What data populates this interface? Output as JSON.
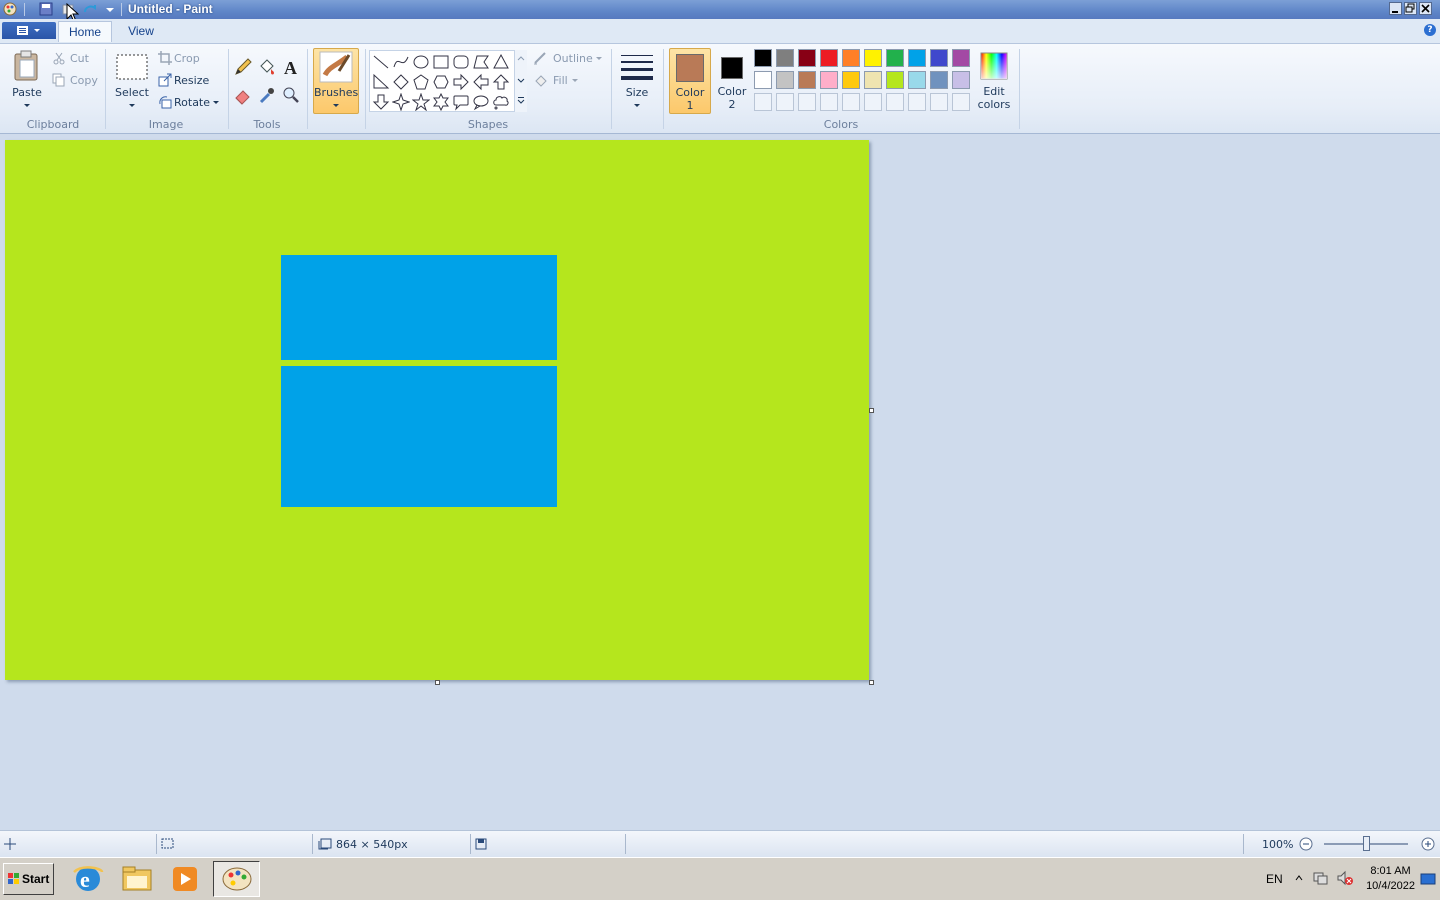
{
  "window": {
    "title": "Untitled - Paint"
  },
  "tabs": {
    "home": "Home",
    "view": "View"
  },
  "ribbon": {
    "clipboard": {
      "paste": "Paste",
      "cut": "Cut",
      "copy": "Copy",
      "group": "Clipboard"
    },
    "image": {
      "select": "Select",
      "crop": "Crop",
      "resize": "Resize",
      "rotate": "Rotate",
      "group": "Image"
    },
    "tools": {
      "group": "Tools"
    },
    "brushes": {
      "label": "Brushes"
    },
    "shapes": {
      "outline": "Outline",
      "fill": "Fill",
      "group": "Shapes"
    },
    "size": {
      "label": "Size"
    },
    "colors": {
      "color1_line1": "Color",
      "color1_line2": "1",
      "color2_line1": "Color",
      "color2_line2": "2",
      "edit_line1": "Edit",
      "edit_line2": "colors",
      "group": "Colors",
      "color1_value": "#b97a57",
      "color2_value": "#000000",
      "palette_row1": [
        "#000000",
        "#7f7f7f",
        "#880015",
        "#ed1c24",
        "#ff7f27",
        "#fff200",
        "#22b14c",
        "#00a2e8",
        "#3f48cc",
        "#a349a4"
      ],
      "palette_row2": [
        "#ffffff",
        "#c3c3c3",
        "#b97a57",
        "#ffaec9",
        "#ffc90e",
        "#efe4b0",
        "#b5e61d",
        "#99d9ea",
        "#7092be",
        "#c8bfe7"
      ]
    }
  },
  "canvas": {
    "background": "#b5e61d",
    "shape_color": "#00a2e8"
  },
  "status": {
    "dimensions": "864 × 540px",
    "zoom": "100%"
  },
  "taskbar": {
    "start": "Start",
    "language": "EN",
    "time": "8:01 AM",
    "date": "10/4/2022"
  }
}
